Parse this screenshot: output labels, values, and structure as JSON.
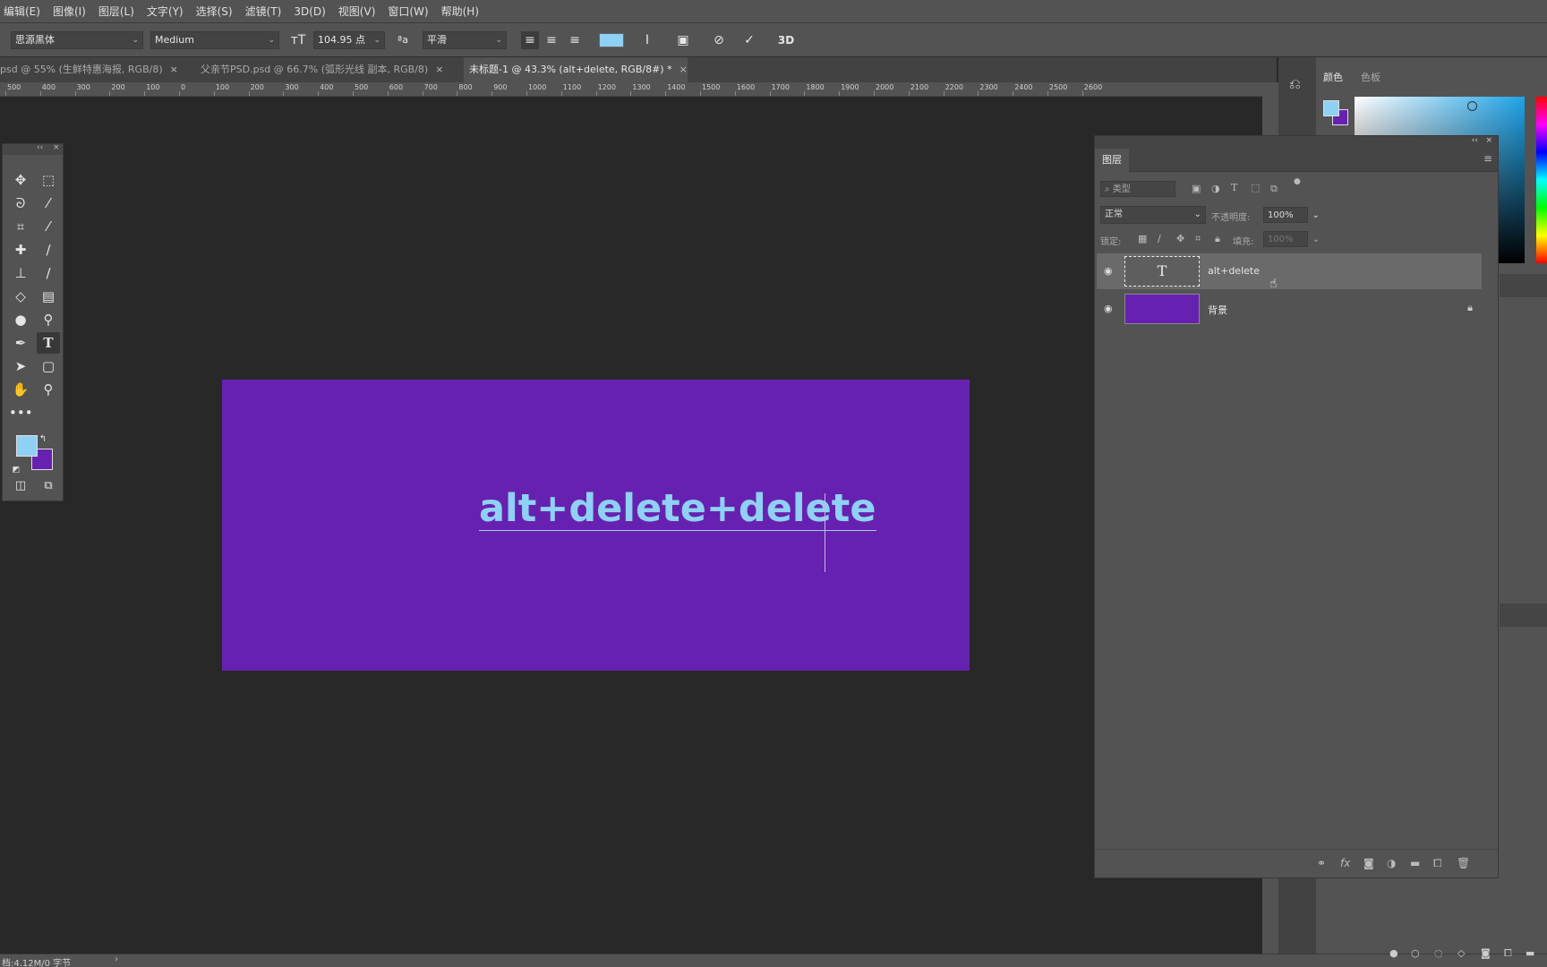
{
  "menu": [
    "编辑(E)",
    "图像(I)",
    "图层(L)",
    "文字(Y)",
    "选择(S)",
    "滤镜(T)",
    "3D(D)",
    "视图(V)",
    "窗口(W)",
    "帮助(H)"
  ],
  "options": {
    "font_family": "思源黑体",
    "font_style": "Medium",
    "font_size": "104.95 点",
    "antialias": "平滑",
    "size_icon": "font-size-icon",
    "antialias_icon": "antialias-icon",
    "text_color": "#8fd1f4",
    "three_d": "3D"
  },
  "tabs": [
    {
      "label": "psd @ 55% (生鲜特惠海报, RGB/8)",
      "close": "×"
    },
    {
      "label": "父亲节PSD.psd @ 66.7% (弧形光线 副本, RGB/8)",
      "close": "×"
    },
    {
      "label": "未标题-1 @ 43.3% (alt+delete, RGB/8#) *",
      "close": "×"
    }
  ],
  "ruler": [
    "500",
    "400",
    "300",
    "200",
    "100",
    "0",
    "100",
    "200",
    "300",
    "400",
    "500",
    "600",
    "700",
    "800",
    "900",
    "1000",
    "1100",
    "1200",
    "1300",
    "1400",
    "1500",
    "1600",
    "1700",
    "1800",
    "1900",
    "2000",
    "2100",
    "2200",
    "2300",
    "2400",
    "2500",
    "2600"
  ],
  "canvas": {
    "text": "alt+delete+delete",
    "background_color": "#6721b0",
    "text_color": "#8fd1f4"
  },
  "colors": {
    "foreground": "#8fd1f4",
    "background": "#6721b0"
  },
  "color_panel": {
    "tab_color": "颜色",
    "tab_swatches": "色板"
  },
  "layers_panel": {
    "title": "图层",
    "filter_placeholder": "类型",
    "blend_mode": "正常",
    "opacity_label": "不透明度:",
    "opacity_value": "100%",
    "lock_label": "锁定:",
    "fill_label": "填充:",
    "fill_value": "100%",
    "layers": [
      {
        "name": "alt+delete",
        "thumb": "T",
        "selected": true
      },
      {
        "name": "背景",
        "locked": true
      }
    ]
  },
  "status": {
    "text": "档:4.12M/0 字节",
    "arrow": "›"
  }
}
